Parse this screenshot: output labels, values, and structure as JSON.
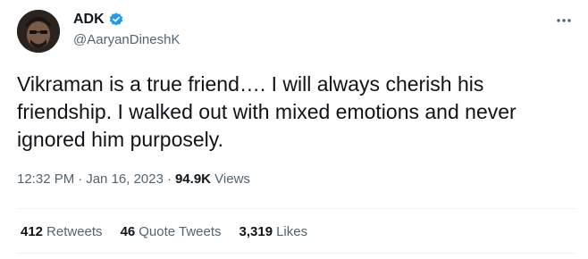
{
  "author": {
    "display_name": "ADK",
    "handle": "@AaryanDineshK",
    "verified_icon": "verified-badge-icon",
    "verified_color": "#1d9bf0"
  },
  "tweet": {
    "lines": [
      "Vikraman is a true friend…. I will always cherish his",
      "friendship. I walked out with mixed emotions and never",
      "ignored him purposely."
    ],
    "time": "12:32 PM",
    "date": "Jan 16, 2023",
    "separator": "·",
    "views_count": "94.9K",
    "views_label": "Views"
  },
  "stats": {
    "retweets_count": "412",
    "retweets_label": "Retweets",
    "quotes_count": "46",
    "quotes_label": "Quote Tweets",
    "likes_count": "3,319",
    "likes_label": "Likes"
  },
  "icons": {
    "more": "more-options-icon"
  }
}
